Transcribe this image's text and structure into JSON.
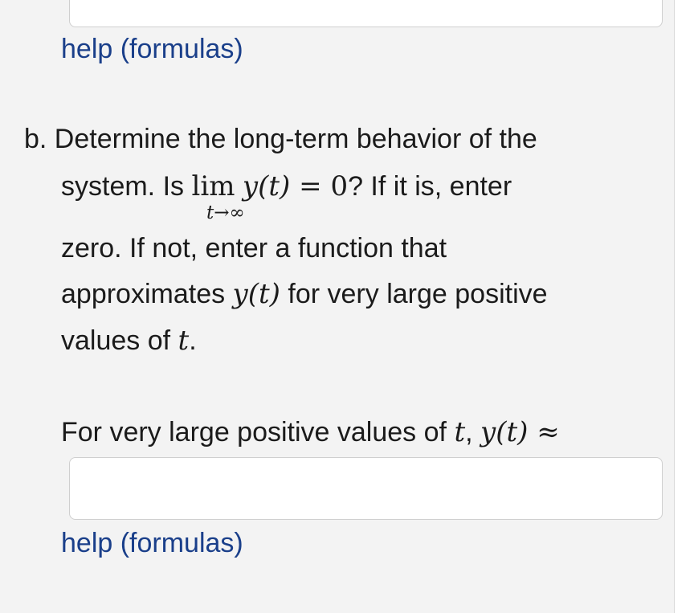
{
  "help_links": [
    "help (formulas)",
    "help (formulas)"
  ],
  "question_b": {
    "line1": "b. Determine the long-term behavior of the",
    "line2_pre": "system. Is ",
    "lim": "lim",
    "line2_math": "y(t)",
    "eq": " = ",
    "zero": "0",
    "line2_post": "? If it is, enter",
    "lim_sub": "t→∞",
    "line3": "zero. If not, enter a function that",
    "line4_pre": "approximates ",
    "line4_math": "y(t)",
    "line4_post": " for very large positive",
    "line5_pre": "values of ",
    "line5_math": "t",
    "line5_post": "."
  },
  "answer_prompt": {
    "pre": "For very large positive values of ",
    "t": "t",
    "comma": ", ",
    "y": "y(t)",
    "approx": " ≈"
  },
  "inputs": {
    "answer1_value": "",
    "answer2_value": ""
  }
}
